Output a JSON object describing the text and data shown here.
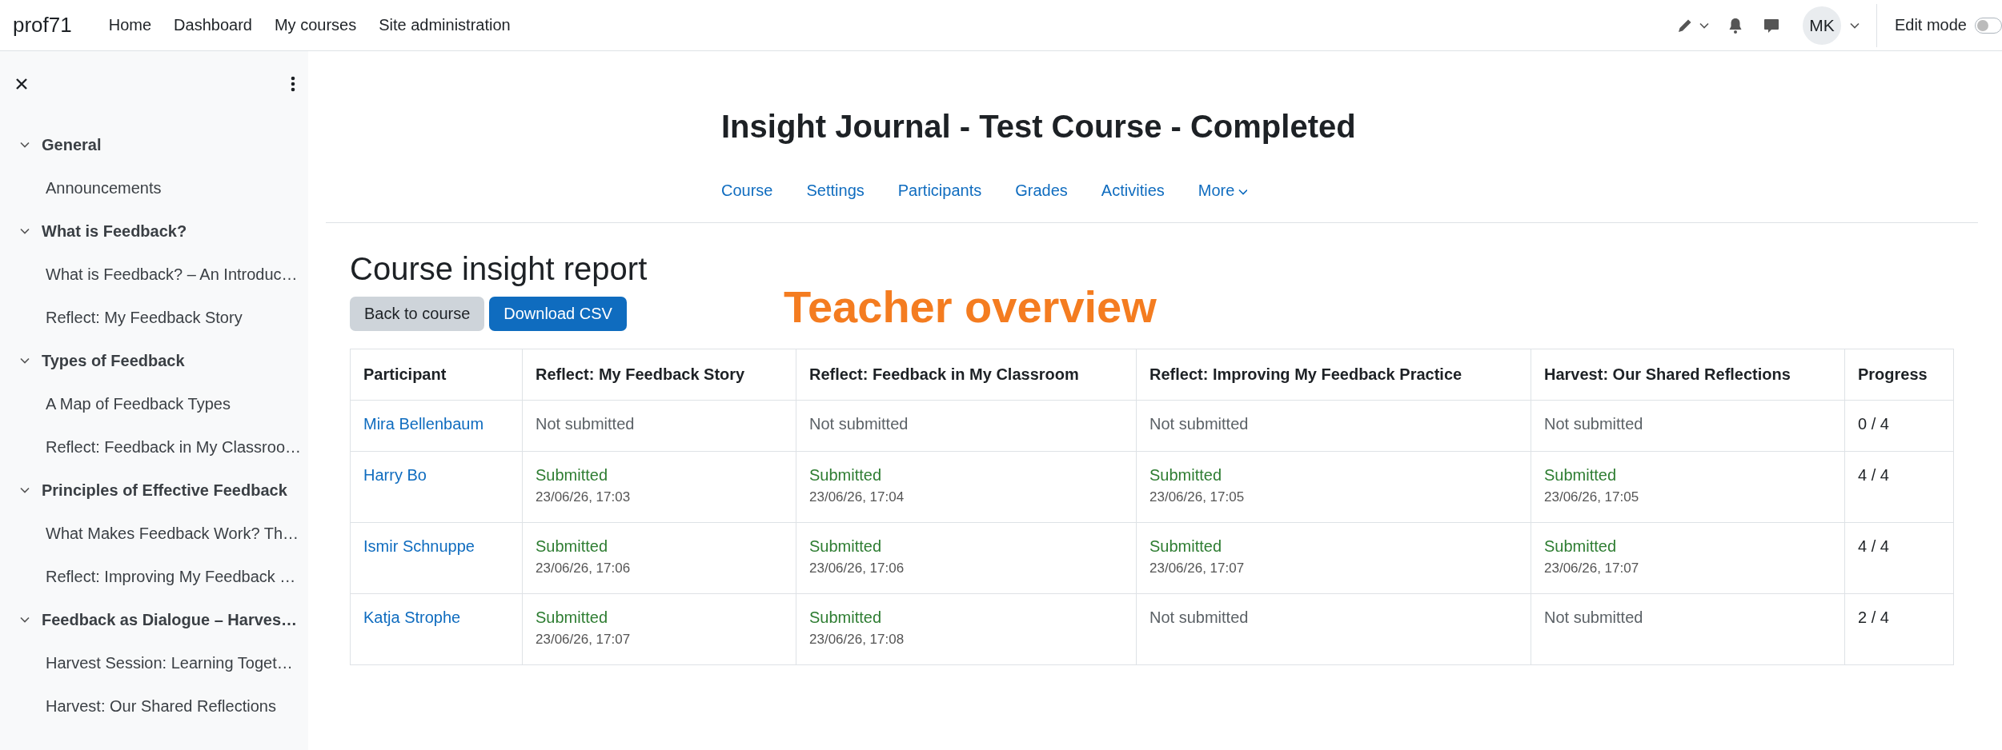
{
  "navbar": {
    "brand": "prof71",
    "links": [
      "Home",
      "Dashboard",
      "My courses",
      "Site administration"
    ],
    "avatar": "MK",
    "edit_mode": {
      "label": "Edit mode",
      "on": false
    }
  },
  "sidebar": {
    "sections": [
      {
        "title": "General",
        "expanded": true,
        "children": [
          {
            "label": "Announcements"
          }
        ]
      },
      {
        "title": "What is Feedback?",
        "expanded": true,
        "children": [
          {
            "label": "What is Feedback? – An Introduc…"
          },
          {
            "label": "Reflect: My Feedback Story"
          }
        ]
      },
      {
        "title": "Types of Feedback",
        "expanded": true,
        "children": [
          {
            "label": "A Map of Feedback Types"
          },
          {
            "label": "Reflect: Feedback in My Classroo…"
          }
        ]
      },
      {
        "title": "Principles of Effective Feedback",
        "expanded": true,
        "children": [
          {
            "label": "What Makes Feedback Work? Th…"
          },
          {
            "label": "Reflect: Improving My Feedback …"
          }
        ]
      },
      {
        "title": "Feedback as Dialogue – Harves…",
        "expanded": true,
        "children": [
          {
            "label": "Harvest Session: Learning Toget…"
          },
          {
            "label": "Harvest: Our Shared Reflections"
          }
        ]
      }
    ]
  },
  "course": {
    "title": "Insight Journal - Test Course - Completed",
    "tabs": [
      "Course",
      "Settings",
      "Participants",
      "Grades",
      "Activities",
      "More"
    ]
  },
  "report": {
    "title": "Course insight report",
    "buttons": [
      {
        "label": "Back to course",
        "kind": "secondary"
      },
      {
        "label": "Download CSV",
        "kind": "primary"
      }
    ],
    "annotation": "Teacher overview",
    "table": {
      "columns": [
        "Participant",
        "Reflect: My Feedback Story",
        "Reflect: Feedback in My Classroom",
        "Reflect: Improving My Feedback Practice",
        "Harvest: Our Shared Reflections",
        "Progress"
      ],
      "rows": [
        {
          "cells": [
            {
              "kind": "participant",
              "text": "Mira Bellenbaum"
            },
            {
              "kind": "status",
              "submitted": false,
              "text": "Not submitted"
            },
            {
              "kind": "status",
              "submitted": false,
              "text": "Not submitted"
            },
            {
              "kind": "status",
              "submitted": false,
              "text": "Not submitted"
            },
            {
              "kind": "status",
              "submitted": false,
              "text": "Not submitted"
            },
            {
              "kind": "progress",
              "text": "0 / 4"
            }
          ]
        },
        {
          "cells": [
            {
              "kind": "participant",
              "text": "Harry Bo"
            },
            {
              "kind": "status",
              "submitted": true,
              "text": "Submitted",
              "date": "23/06/26, 17:03"
            },
            {
              "kind": "status",
              "submitted": true,
              "text": "Submitted",
              "date": "23/06/26, 17:04"
            },
            {
              "kind": "status",
              "submitted": true,
              "text": "Submitted",
              "date": "23/06/26, 17:05"
            },
            {
              "kind": "status",
              "submitted": true,
              "text": "Submitted",
              "date": "23/06/26, 17:05"
            },
            {
              "kind": "progress",
              "text": "4 / 4"
            }
          ]
        },
        {
          "cells": [
            {
              "kind": "participant",
              "text": "Ismir Schnuppe"
            },
            {
              "kind": "status",
              "submitted": true,
              "text": "Submitted",
              "date": "23/06/26, 17:06"
            },
            {
              "kind": "status",
              "submitted": true,
              "text": "Submitted",
              "date": "23/06/26, 17:06"
            },
            {
              "kind": "status",
              "submitted": true,
              "text": "Submitted",
              "date": "23/06/26, 17:07"
            },
            {
              "kind": "status",
              "submitted": true,
              "text": "Submitted",
              "date": "23/06/26, 17:07"
            },
            {
              "kind": "progress",
              "text": "4 / 4"
            }
          ]
        },
        {
          "cells": [
            {
              "kind": "participant",
              "text": "Katja Strophe"
            },
            {
              "kind": "status",
              "submitted": true,
              "text": "Submitted",
              "date": "23/06/26, 17:07"
            },
            {
              "kind": "status",
              "submitted": true,
              "text": "Submitted",
              "date": "23/06/26, 17:08"
            },
            {
              "kind": "status",
              "submitted": false,
              "text": "Not submitted"
            },
            {
              "kind": "status",
              "submitted": false,
              "text": "Not submitted"
            },
            {
              "kind": "progress",
              "text": "2 / 4"
            }
          ]
        }
      ]
    }
  }
}
